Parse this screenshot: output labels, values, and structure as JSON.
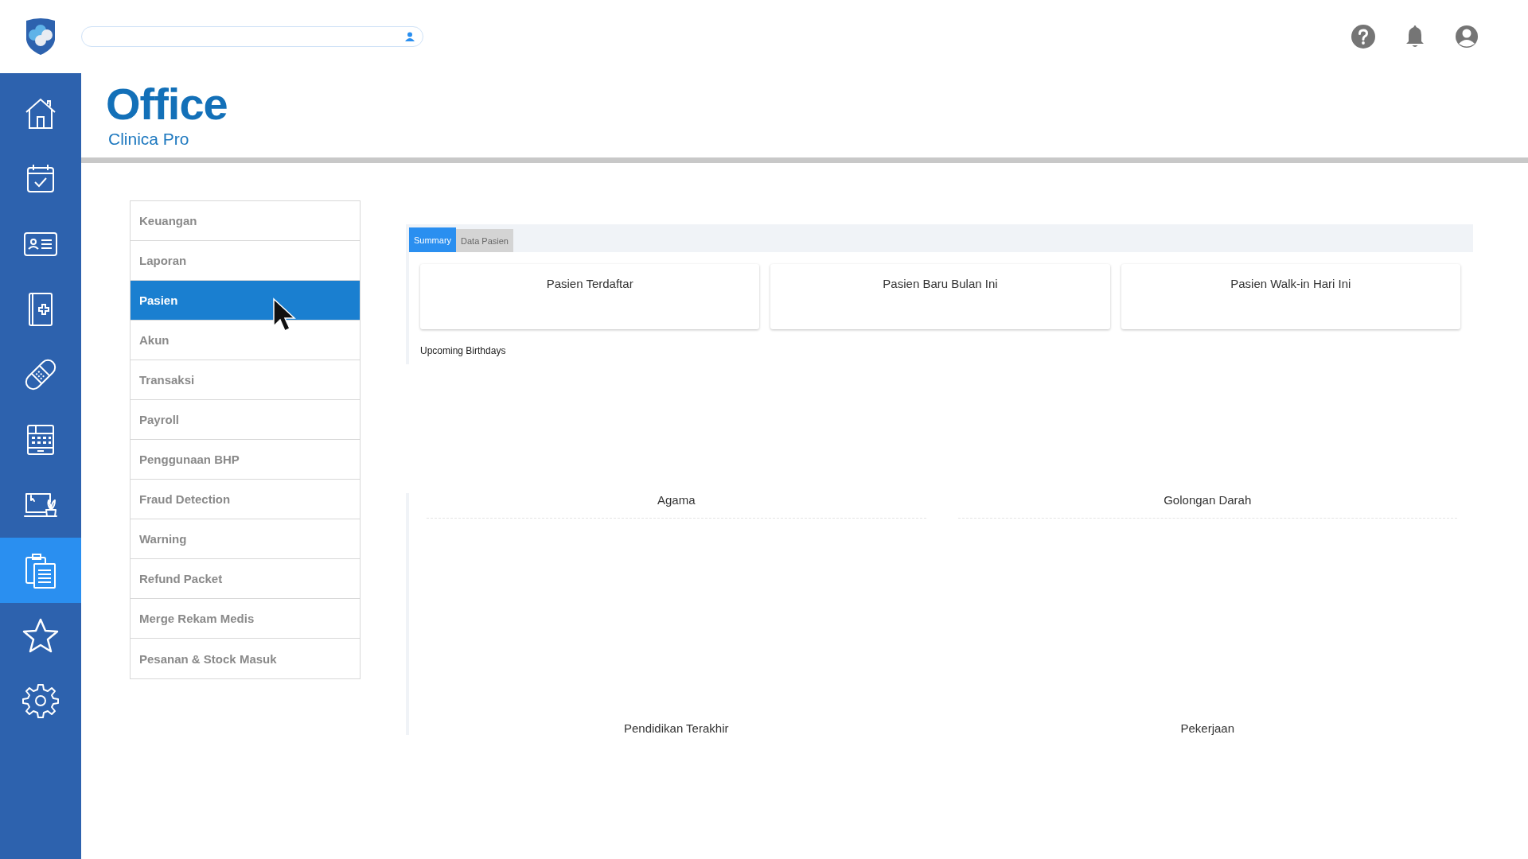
{
  "brand": {
    "title": "Office",
    "subtitle": "Clinica Pro"
  },
  "nav_items": [
    {
      "kind": "home",
      "selected": false
    },
    {
      "kind": "calendar",
      "selected": false
    },
    {
      "kind": "id-card",
      "selected": false
    },
    {
      "kind": "medical-book",
      "selected": false
    },
    {
      "kind": "bandage",
      "selected": false
    },
    {
      "kind": "register",
      "selected": false
    },
    {
      "kind": "monitor",
      "selected": false
    },
    {
      "kind": "clipboard",
      "selected": true
    },
    {
      "kind": "star",
      "selected": false
    },
    {
      "kind": "settings",
      "selected": false
    }
  ],
  "menu": [
    {
      "label": "Keuangan",
      "selected": false
    },
    {
      "label": "Laporan",
      "selected": false
    },
    {
      "label": "Pasien",
      "selected": true
    },
    {
      "label": "Akun",
      "selected": false
    },
    {
      "label": "Transaksi",
      "selected": false
    },
    {
      "label": "Payroll",
      "selected": false
    },
    {
      "label": "Penggunaan BHP",
      "selected": false
    },
    {
      "label": "Fraud Detection",
      "selected": false
    },
    {
      "label": "Warning",
      "selected": false
    },
    {
      "label": "Refund Packet",
      "selected": false
    },
    {
      "label": "Merge Rekam Medis",
      "selected": false
    },
    {
      "label": "Pesanan & Stock Masuk",
      "selected": false
    }
  ],
  "tabs": [
    {
      "label": "Summary",
      "selected": true
    },
    {
      "label": "Data Pasien",
      "selected": false
    }
  ],
  "stat_cards": [
    {
      "title": "Pasien Terdaftar"
    },
    {
      "title": "Pasien Baru Bulan Ini"
    },
    {
      "title": "Pasien Walk-in Hari Ini"
    }
  ],
  "birthdays": {
    "title": "Upcoming Birthdays"
  },
  "chart_panels": [
    {
      "title": "Agama"
    },
    {
      "title": "Golongan Darah"
    },
    {
      "title": "Pendidikan Terakhir"
    },
    {
      "title": "Pekerjaan"
    }
  ]
}
